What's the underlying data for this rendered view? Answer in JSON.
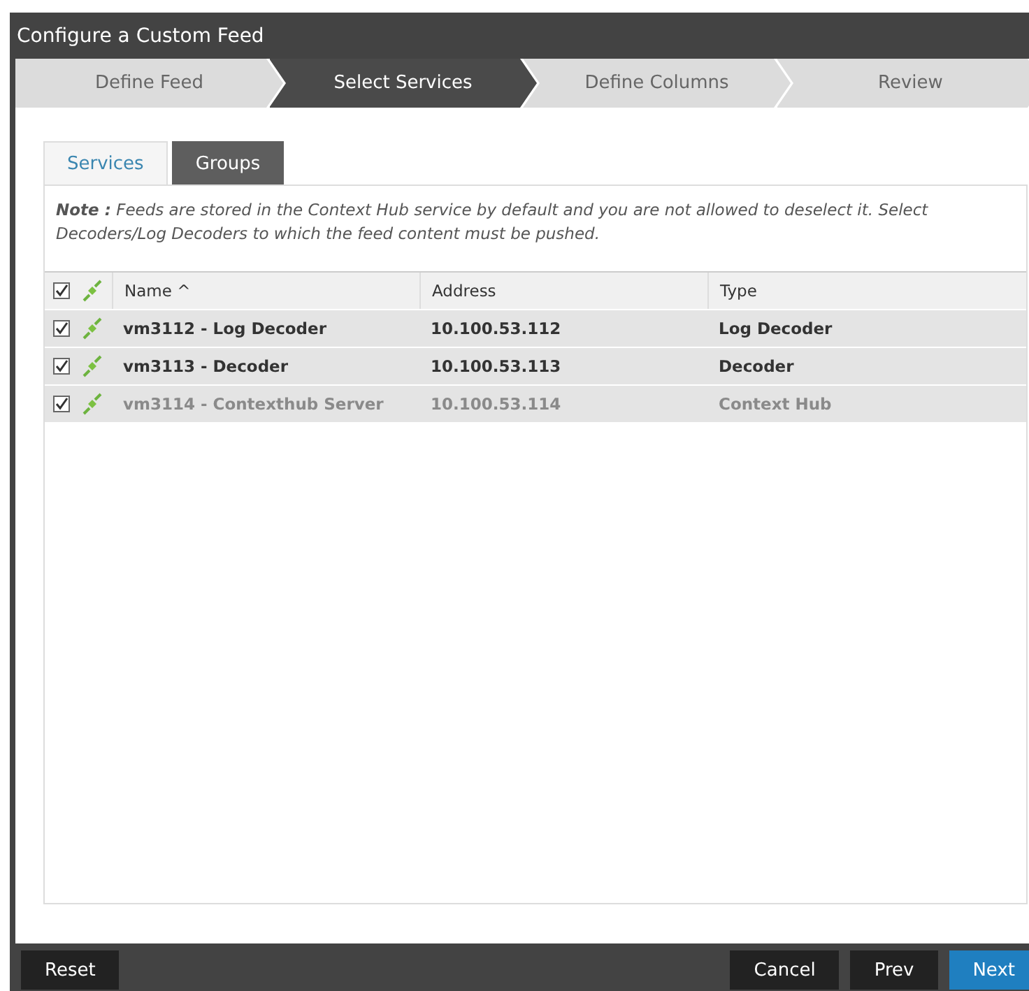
{
  "window": {
    "title": "Configure a Custom Feed"
  },
  "steps": [
    {
      "label": "Define Feed",
      "selected": false
    },
    {
      "label": "Select Services",
      "selected": true
    },
    {
      "label": "Define Columns",
      "selected": false
    },
    {
      "label": "Review",
      "selected": false
    }
  ],
  "tabs": [
    {
      "label": "Services",
      "selected": true
    },
    {
      "label": "Groups",
      "selected": false
    }
  ],
  "note": "**Note :** Feeds are stored in the Context Hub service by default and you are not allowed to deselect it. Select Decoders/Log Decoders to which the feed content must be pushed.",
  "table": {
    "header_checked": true,
    "columns": [
      "Name ^",
      "Address",
      "Type"
    ],
    "rows": [
      {
        "checked": true,
        "disabled": false,
        "cells": [
          "vm3112 - Log Decoder",
          "10.100.53.112",
          "Log Decoder"
        ]
      },
      {
        "checked": true,
        "disabled": false,
        "cells": [
          "vm3113 - Decoder",
          "10.100.53.113",
          "Decoder"
        ]
      },
      {
        "checked": true,
        "disabled": true,
        "cells": [
          "vm3114 - Contexthub Server",
          "10.100.53.114",
          "Context Hub"
        ]
      }
    ]
  },
  "footer": {
    "left_buttons": [
      {
        "label": "Reset",
        "kind": "plain"
      }
    ],
    "right_buttons": [
      {
        "label": "Cancel",
        "kind": "plain"
      },
      {
        "label": "Prev",
        "kind": "plain"
      },
      {
        "label": "Next",
        "kind": "primary"
      }
    ]
  }
}
